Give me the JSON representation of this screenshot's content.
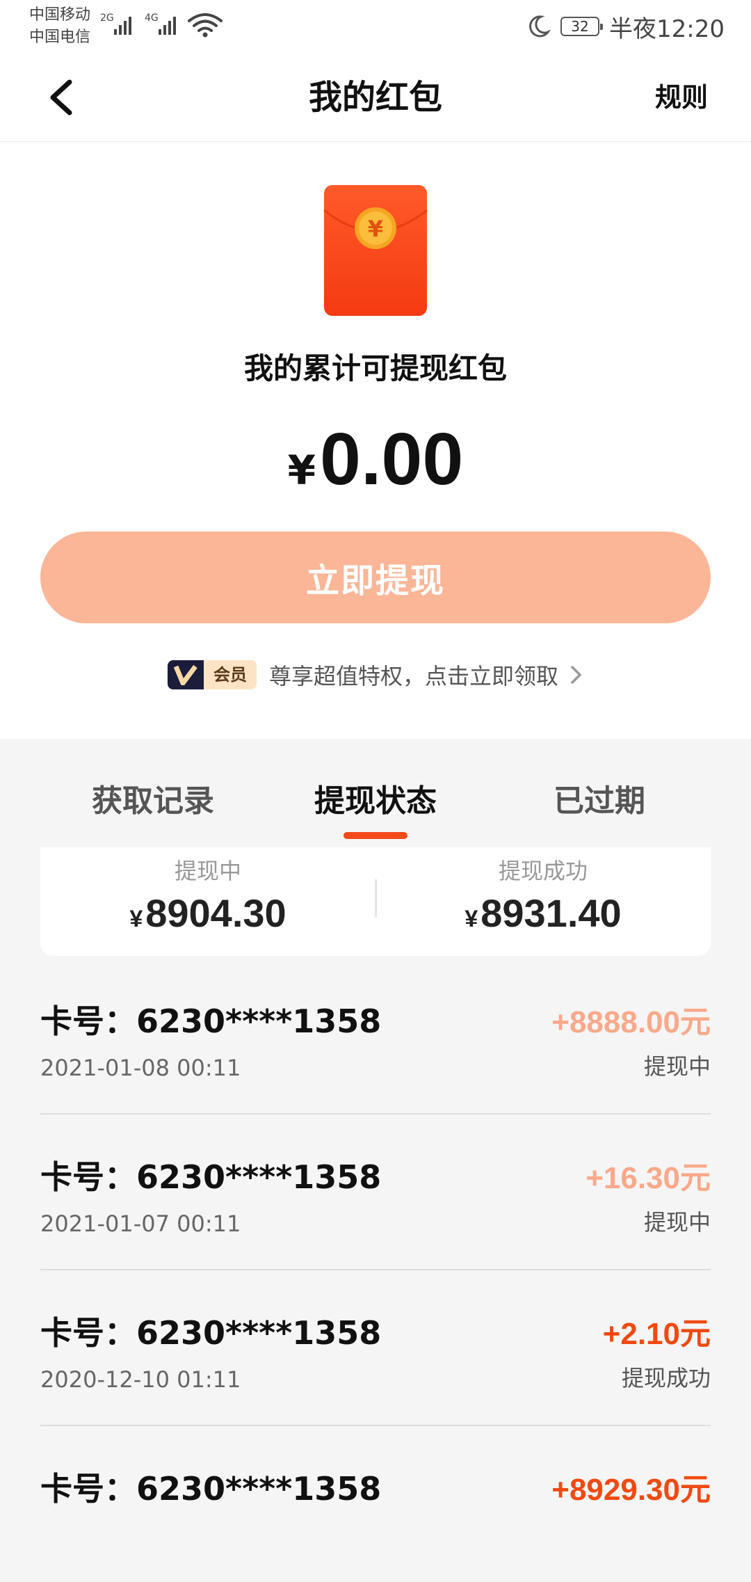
{
  "status_bar": {
    "carrier_1": "中国移动",
    "carrier_2": "中国电信",
    "network_1": "2G",
    "network_2": "4G",
    "battery": "32",
    "time": "半夜12:20"
  },
  "nav": {
    "title": "我的红包",
    "rules_label": "规则"
  },
  "hero": {
    "subtitle": "我的累计可提现红包",
    "currency_symbol": "¥",
    "balance": "0.00",
    "withdraw_label": "立即提现",
    "vip_badge": "会员",
    "vip_text": "尊享超值特权，点击立即领取"
  },
  "tabs": [
    {
      "label": "获取记录",
      "active": false
    },
    {
      "label": "提现状态",
      "active": true
    },
    {
      "label": "已过期",
      "active": false
    }
  ],
  "summary": {
    "pending_label": "提现中",
    "pending_value": "8904.30",
    "success_label": "提现成功",
    "success_value": "8931.40"
  },
  "records": [
    {
      "card": "卡号：6230****1358",
      "date": "2021-01-08 00:11",
      "amount": "+8888.00元",
      "status": "提现中",
      "color": "#f8a98a"
    },
    {
      "card": "卡号：6230****1358",
      "date": "2021-01-07 00:11",
      "amount": "+16.30元",
      "status": "提现中",
      "color": "#f8a98a"
    },
    {
      "card": "卡号：6230****1358",
      "date": "2020-12-10 01:11",
      "amount": "+2.10元",
      "status": "提现成功",
      "color": "#f04a12"
    },
    {
      "card": "卡号：6230****1358",
      "date": "",
      "amount": "+8929.30元",
      "status": "",
      "color": "#f04a12"
    }
  ],
  "colors": {
    "accent": "#f24a1b",
    "button_disabled": "#fbb698",
    "envelope": "#ff4a1c"
  }
}
